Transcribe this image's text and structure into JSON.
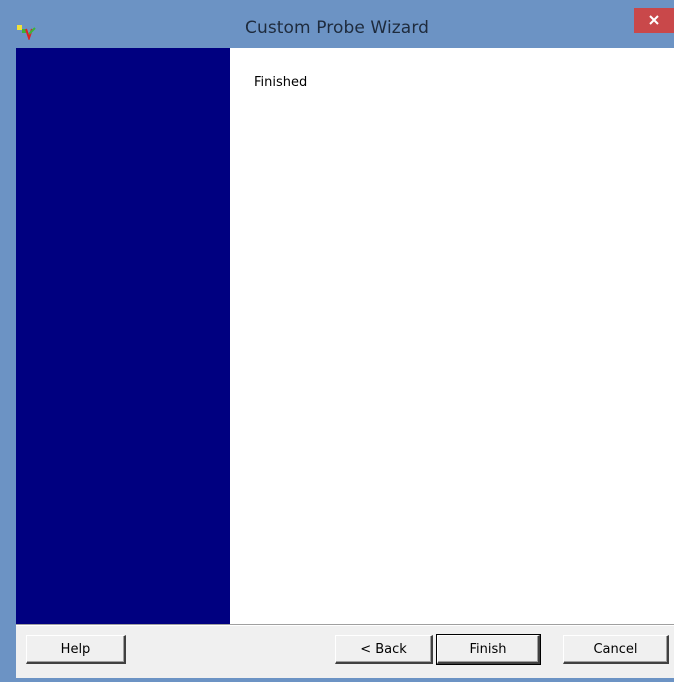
{
  "window": {
    "title": "Custom Probe Wizard",
    "app_icon": "probe-waveform-icon",
    "close_icon": "close-icon",
    "colors": {
      "frame": "#6c93c4",
      "close_button": "#c9484a",
      "side_panel": "#000080",
      "content": "#ffffff"
    }
  },
  "main": {
    "page_heading": "Finished"
  },
  "buttons": {
    "help": "Help",
    "back": "< Back",
    "finish": "Finish",
    "cancel": "Cancel"
  }
}
